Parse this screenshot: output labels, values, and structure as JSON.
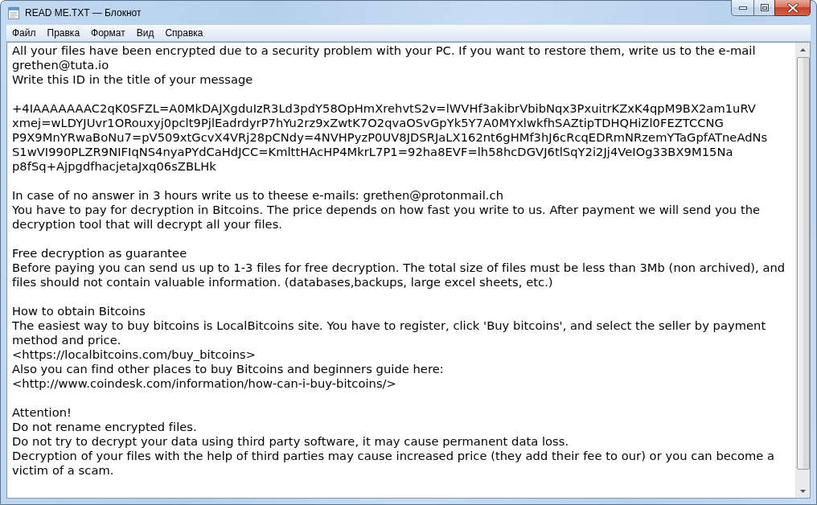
{
  "window": {
    "title": "READ ME.TXT — Блокнот"
  },
  "menu": [
    {
      "label": "Файл"
    },
    {
      "label": "Правка"
    },
    {
      "label": "Формат"
    },
    {
      "label": "Вид"
    },
    {
      "label": "Справка"
    }
  ],
  "document": {
    "blocks": [
      {
        "lines": [
          "All your files have been encrypted due to a security problem with your PC. If you want to restore them, write us to the e-mail grethen@tuta.io",
          "Write this ID in the title of your message"
        ]
      },
      {
        "lines": [
          "+4IAAAAAAAC2qK0SFZL=A0MkDAJXgduIzR3Ld3pdY58OpHmXrehvtS2v=lWVHf3akibrVbibNqx3PxuitrKZxK4qpM9BX2am1uRV",
          "xmej=wLDYJUvr1ORouxyj0pclt9PjlEadrdyrP7hYu2rz9xZwtK7O2qvaOSvGpYk5Y7A0MYxlwkfhSAZtipTDHQHiZl0FEZTCCNG",
          "P9X9MnYRwaBoNu7=pV509xtGcvX4VRj28pCNdy=4NVHPyzP0UV8JDSRJaLX162nt6gHMf3hJ6cRcqEDRmNRzemYTaGpfATneAdNs",
          "S1wVI990PLZR9NIFIqNS4nyaPYdCaHdJCC=KmlttHAcHP4MkrL7P1=92ha8EVF=lh58hcDGVJ6tlSqY2i2Jj4VeIOg33BX9M15Na",
          "p8fSq+AjpgdfhacjetaJxq06sZBLHk"
        ]
      },
      {
        "lines": [
          "In case of no answer in 3 hours write us to theese e-mails: grethen@protonmail.ch",
          "You have to pay for decryption in Bitcoins. The price depends on how fast you write to us. After payment we will send you the decryption tool that will decrypt all your files."
        ]
      },
      {
        "lines": [
          "Free decryption as guarantee",
          "Before paying you can send us up to 1-3 files for free decryption. The total size of files must be less than 3Mb (non archived), and files should not contain valuable information. (databases,backups, large excel sheets, etc.)"
        ]
      },
      {
        "lines": [
          "How to obtain Bitcoins",
          "The easiest way to buy bitcoins is LocalBitcoins site. You have to register, click 'Buy bitcoins', and select the seller by payment method and price.",
          "<https://localbitcoins.com/buy_bitcoins>",
          "Also you can find other places to buy Bitcoins and beginners guide here:",
          "<http://www.coindesk.com/information/how-can-i-buy-bitcoins/>"
        ]
      },
      {
        "lines": [
          "Attention!",
          "Do not rename encrypted files.",
          "Do not try to decrypt your data using third party software, it may cause permanent data loss.",
          "Decryption of your files with the help of third parties may cause increased price (they add their fee to our) or you can become a victim of a scam."
        ]
      }
    ]
  }
}
